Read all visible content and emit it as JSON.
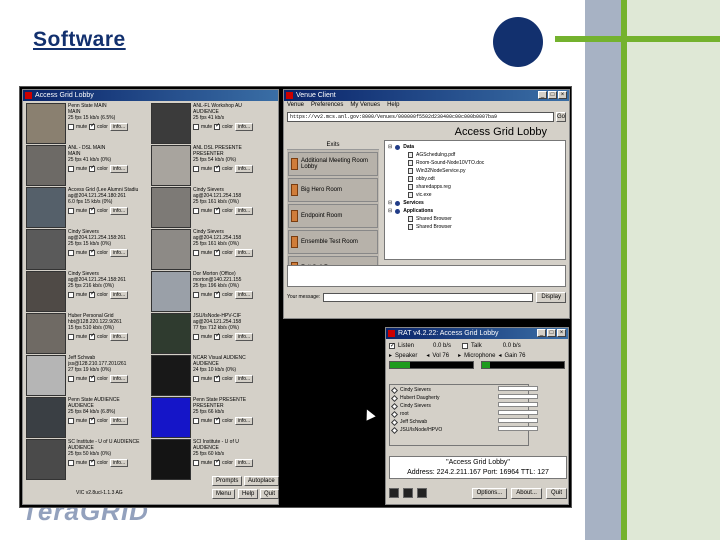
{
  "slide": {
    "title": "Software"
  },
  "vic": {
    "title": "Access Grid Lobby",
    "cells": [
      {
        "l1": "Penn State MAIN",
        "l2": "MAIN",
        "l3": "25 fps   15 kb/s   (6.5%)",
        "mute": "mute",
        "color": "color",
        "info": "info..."
      },
      {
        "l1": "ANL-FL Workshop AU",
        "l2": "AUDIENCE",
        "l3": "25 fps   41 kb/s",
        "mute": "mute",
        "color": "color",
        "info": "info..."
      },
      {
        "l1": "ANL - DSL MAIN",
        "l2": "MAIN",
        "l3": "25 fps   41 kb/s   (0%)",
        "mute": "mute",
        "color": "color",
        "info": "info..."
      },
      {
        "l1": "ANL DSL PRESENTE",
        "l2": "PRESENTER",
        "l3": "25 fps   54 kb/s   (0%)",
        "mute": "mute",
        "color": "color",
        "info": "info..."
      },
      {
        "l1": "Access Grid (Lee Alumni Stadiu",
        "l2": "ag@204.121.254.180:261",
        "l3": "6.0 fps   15 kb/s   (0%)",
        "mute": "mute",
        "color": "color",
        "info": "info..."
      },
      {
        "l1": "Cindy Sievers",
        "l2": "ag@204.121.254.158",
        "l3": "25 fps   161 kb/s   (0%)",
        "mute": "mute",
        "color": "color",
        "info": "info..."
      },
      {
        "l1": "Cindy Sievers",
        "l2": "ag@204.121.254.158:261",
        "l3": "25 fps   15 kb/s   (0%)",
        "mute": "mute",
        "color": "color",
        "info": "info..."
      },
      {
        "l1": "Cindy Sievers",
        "l2": "ag@204.121.254.158",
        "l3": "25 fps   161 kb/s   (0%)",
        "mute": "mute",
        "color": "color",
        "info": "info..."
      },
      {
        "l1": "Cindy Sievers",
        "l2": "ag@204.121.254.158:261",
        "l3": "25 fps   216 kb/s   (0%)",
        "mute": "mute",
        "color": "color",
        "info": "info..."
      },
      {
        "l1": "Dor Morton (Office)",
        "l2": "morton@140.221.155",
        "l3": "25 fps   196 kb/s   (0%)",
        "mute": "mute",
        "color": "color",
        "info": "info..."
      },
      {
        "l1": "Huber Personal Grid",
        "l2": "hbt@128.220.122.9/261",
        "l3": "15 fps   510 kb/s   (0%)",
        "mute": "mute",
        "color": "color",
        "info": "info..."
      },
      {
        "l1": "JSU/IsNode-HPV-CIF",
        "l2": "ag@204.121.254.158",
        "l3": "77 fps   712 kb/s   (0%)",
        "mute": "mute",
        "color": "color",
        "info": "info..."
      },
      {
        "l1": "Jeff Schwab",
        "l2": "jss@128.210.177.201/261",
        "l3": "27 fps   19 kb/s   (0%)",
        "mute": "mute",
        "color": "color",
        "info": "info..."
      },
      {
        "l1": "NCAR Visual AUDIENC",
        "l2": "AUDIENCE",
        "l3": "24 fps   10 kb/s   (0%)",
        "mute": "mute",
        "color": "color",
        "info": "info..."
      },
      {
        "l1": "Penn State AUDIENCE",
        "l2": "AUDIENCE",
        "l3": "25 fps   84 kb/s   (6.8%)",
        "mute": "mute",
        "color": "color",
        "info": "info..."
      },
      {
        "l1": "Penn State PRESENTE",
        "l2": "PRESENTER",
        "l3": "25 fps   66 kb/s",
        "mute": "mute",
        "color": "color",
        "info": "info..."
      },
      {
        "l1": "SC Institute - U of U AUDIENCE",
        "l2": "AUDIENCE",
        "l3": "25 fps   50 kb/s   (0%)",
        "mute": "mute",
        "color": "color",
        "info": "info..."
      },
      {
        "l1": "SCI Institute - U of U",
        "l2": "AUDIENCE",
        "l3": "25 fps   60 kb/s",
        "mute": "mute",
        "color": "color",
        "info": "info..."
      }
    ],
    "thumb_colors": [
      "#8a8070",
      "#3b3b3b",
      "#6d6a66",
      "#a8a49e",
      "#55606a",
      "#7d7a76",
      "#5a5a5a",
      "#8d8a86",
      "#4f4a46",
      "#9aa0a8",
      "#6f6a64",
      "#2f3b2f",
      "#b5b5b5",
      "#181818",
      "#3a3f44",
      "#1515c8",
      "#4a4a4a",
      "#141414"
    ],
    "version": "VIC v2.8ucl-1.1.3 AG",
    "btn_prompts": "Prompts",
    "btn_autoplace": "Autoplace",
    "btn_menu": "Menu",
    "btn_help": "Help",
    "btn_quit": "Quit"
  },
  "venue": {
    "title": "Venue Client",
    "menu": [
      "Venue",
      "Preferences",
      "My Venues",
      "Help"
    ],
    "url": "https://vv2.mcs.anl.gov:8000/Venues/000000f5502d230400c00c000b0007ba9",
    "go": "Go",
    "lobby": "Access Grid Lobby",
    "exits_label": "Exits",
    "exits": [
      "Additional Meeting Room Lobby",
      "Big Hero Room",
      "Endpoint Room",
      "Ensemble Test Room",
      "Full Sail Room"
    ],
    "tree": [
      {
        "kind": "folder",
        "text": "Data"
      },
      {
        "kind": "file",
        "text": "AGSchedulng.pdf"
      },
      {
        "kind": "file",
        "text": "Room-Sound-Node10VTO.doc"
      },
      {
        "kind": "file",
        "text": "Win32NodeService.py"
      },
      {
        "kind": "file",
        "text": "obby.odt"
      },
      {
        "kind": "file",
        "text": "sharedapps.reg"
      },
      {
        "kind": "file",
        "text": "vic.exe"
      },
      {
        "kind": "folder",
        "text": "Services"
      },
      {
        "kind": "folder",
        "text": "Applications"
      },
      {
        "kind": "file",
        "text": "Shared Browser"
      },
      {
        "kind": "file",
        "text": "Shared Browser"
      }
    ],
    "message_label": "Your message:",
    "display": "Display"
  },
  "rat": {
    "title": "RAT v4.2.22: Access Grid Lobby",
    "listen": "Listen",
    "listen_rate": "0.0 b/s",
    "talk": "Talk",
    "talk_rate": "0.0 b/s",
    "speaker": "Speaker",
    "vol": "Vol 76",
    "microphone": "Microphone",
    "gain": "Gain 76",
    "participants": [
      "Cindy Sievers",
      "Hubert Daugherty",
      "Cindy Sievers",
      "root",
      "Jeff Schwab",
      "JSU/IsNode/HPVO"
    ],
    "session_name": "\"Access Grid Lobby\"",
    "session_addr": "Address: 224.2.211.167 Port: 16964 TTL: 127",
    "options": "Options...",
    "about": "About...",
    "quit": "Quit"
  }
}
